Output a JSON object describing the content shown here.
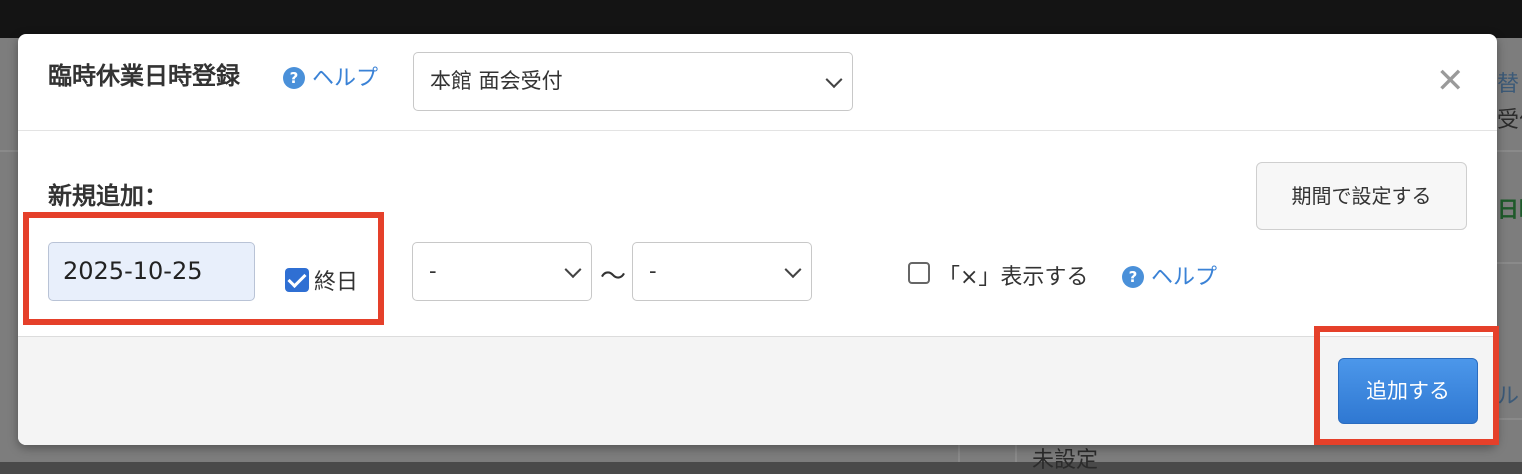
{
  "background": {
    "right_top_text": "替",
    "right_text_2": "受付",
    "right_green": "日時",
    "right_blue": "ルフ",
    "bottom_text": "未設定"
  },
  "dialog": {
    "title": "臨時休業日時登録",
    "title_help_label": "ヘルプ",
    "location_select": {
      "selected": "本館 面会受付"
    },
    "close_label": "✕",
    "new_section_label": "新規追加：",
    "period_button_label": "期間で設定する",
    "date_value": "2025-10-25",
    "all_day": {
      "label": "終日",
      "checked": true
    },
    "start_time_select": {
      "selected": "-"
    },
    "range_separator": "〜",
    "end_time_select": {
      "selected": "-"
    },
    "show_x": {
      "label": "「×」表示する",
      "checked": false
    },
    "show_x_help_label": "ヘルプ",
    "add_button_label": "追加する"
  },
  "colors": {
    "accent_blue": "#2f78d2",
    "link_blue": "#3a82d6",
    "highlight_red": "#e5402a"
  },
  "icons": {
    "help": "question-circle",
    "close": "x-mark",
    "dropdown": "chevron-down"
  }
}
